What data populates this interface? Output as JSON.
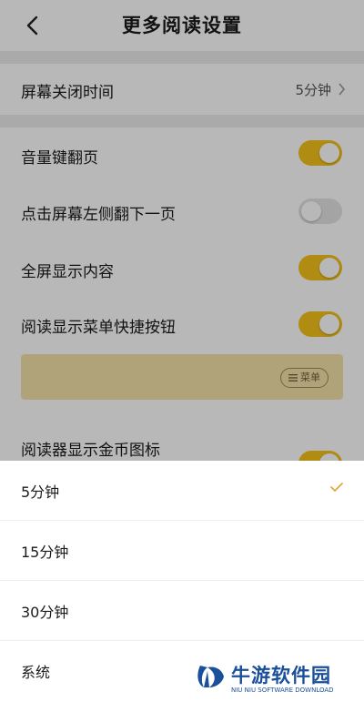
{
  "header": {
    "title": "更多阅读设置",
    "back_icon": "chevron-left-icon"
  },
  "screen_off": {
    "label": "屏幕关闭时间",
    "value": "5分钟"
  },
  "settings": [
    {
      "label": "音量键翻页",
      "state": "on"
    },
    {
      "label": "点击屏幕左侧翻下一页",
      "state": "off"
    },
    {
      "label": "全屏显示内容",
      "state": "on"
    },
    {
      "label": "阅读显示菜单快捷按钮",
      "state": "on"
    },
    {
      "label": "阅读器显示金币图标",
      "state": "on"
    }
  ],
  "preview": {
    "menu_chip_label": "菜单",
    "menu_chip_icon": "hamburger-icon"
  },
  "sheet": {
    "options": [
      {
        "label": "5分钟",
        "selected": true
      },
      {
        "label": "15分钟",
        "selected": false
      },
      {
        "label": "30分钟",
        "selected": false
      },
      {
        "label": "系统",
        "selected": false
      }
    ],
    "check_icon": "checkmark-icon"
  },
  "watermark": {
    "title": "牛游软件园",
    "subtitle": "NIU NIU SOFTWARE DOWNLOAD"
  },
  "colors": {
    "accent": "#f4c21a",
    "toggle_off": "#e3e3e3",
    "watermark": "#1a4f9a"
  }
}
